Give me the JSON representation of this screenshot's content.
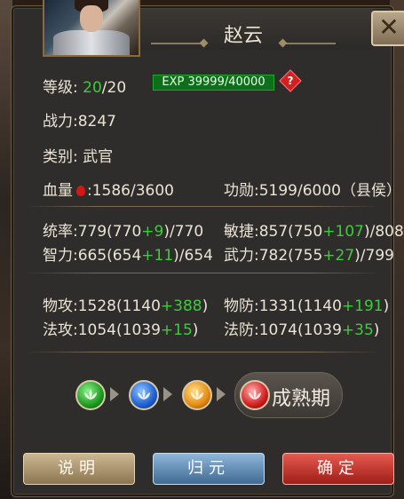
{
  "hero": {
    "name": "赵云"
  },
  "level": {
    "label": "等级:",
    "current": "20",
    "max": "/20"
  },
  "exp": {
    "text": "EXP 39999/40000"
  },
  "power": {
    "text": "战力:8247"
  },
  "category": {
    "label": "类别:",
    "value": "武官"
  },
  "hp": {
    "label": "血量",
    "value": ":1586/3600"
  },
  "merit": {
    "text": "功勋:5199/6000（县侯）"
  },
  "stats": {
    "command": {
      "pre": "统率:779(770",
      "bonus": "+9",
      "post": ")/770"
    },
    "agility": {
      "pre": "敏捷:857(750",
      "bonus": "+107",
      "post": ")/808"
    },
    "intellect": {
      "pre": "智力:665(654",
      "bonus": "+11",
      "post": ")/654"
    },
    "force": {
      "pre": "武力:782(755",
      "bonus": "+27",
      "post": ")/799"
    },
    "phys_atk": {
      "pre": "物攻:1528(1140",
      "bonus": "+388",
      "post": ")"
    },
    "phys_def": {
      "pre": "物防:1331(1140",
      "bonus": "+191",
      "post": ")"
    },
    "mag_atk": {
      "pre": "法攻:1054(1039",
      "bonus": "+15",
      "post": ")"
    },
    "mag_def": {
      "pre": "法防:1074(1039",
      "bonus": "+35",
      "post": ")"
    }
  },
  "growth": {
    "stage_label": "成熟期"
  },
  "buttons": {
    "explain": "说明",
    "reset": "归元",
    "confirm": "确定"
  },
  "colors": {
    "bonus_green": "#3fca3f",
    "exp_bar": "#0f6e1c"
  }
}
